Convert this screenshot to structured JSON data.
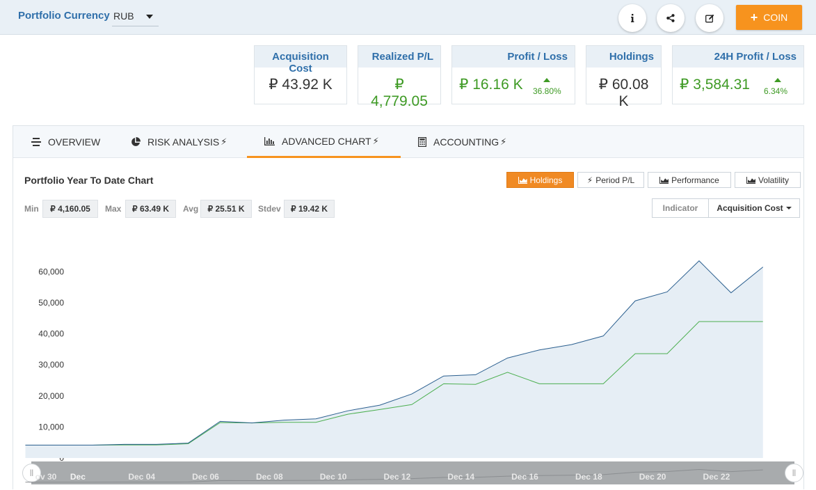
{
  "header": {
    "currency_label": "Portfolio Currency",
    "currency_value": "RUB",
    "info_icon": "info-icon",
    "share_icon": "share-icon",
    "edit_icon": "edit-icon",
    "add_button": "COIN"
  },
  "stats": {
    "acquisition_cost": {
      "label": "Acquisition Cost",
      "value": "₽ 43.92 K"
    },
    "realized_pl": {
      "label": "Realized P/L",
      "value": "₽ 4,779.05"
    },
    "profit_loss": {
      "label": "Profit / Loss",
      "value": "₽ 16.16 K",
      "pct": "36.80%"
    },
    "holdings": {
      "label": "Holdings",
      "value": "₽ 60.08 K"
    },
    "profit_24h": {
      "label": "24H Profit / Loss",
      "value": "₽ 3,584.31",
      "pct": "6.34%"
    }
  },
  "tabs": [
    {
      "label": "OVERVIEW",
      "icon": "list-icon"
    },
    {
      "label": "RISK ANALYSIS",
      "icon": "pie-icon"
    },
    {
      "label": "ADVANCED CHART",
      "icon": "bar-chart-icon",
      "active": true
    },
    {
      "label": "ACCOUNTING",
      "icon": "calculator-icon"
    }
  ],
  "chart_panel": {
    "title": "Portfolio Year To Date Chart",
    "type_buttons": [
      "Holdings",
      "Period P/L",
      "Performance",
      "Volatility"
    ],
    "active_type": "Holdings",
    "summary": {
      "min_label": "Min",
      "min_value": "₽ 4,160.05",
      "max_label": "Max",
      "max_value": "₽ 63.49 K",
      "avg_label": "Avg",
      "avg_value": "₽ 25.51 K",
      "stdev_label": "Stdev",
      "stdev_value": "₽ 19.42 K"
    },
    "indicator_label": "Indicator",
    "indicator_value": "Acquisition Cost"
  },
  "colors": {
    "accent": "#f7931e",
    "brand_blue": "#2f6faa",
    "green": "#3e9a24",
    "holdings_line": "#2b5f8f",
    "holdings_fill": "#e6eef5",
    "cost_line": "#4caf50"
  },
  "chart_data": {
    "type": "area",
    "ylim": [
      0,
      65000
    ],
    "y_ticks": [
      "0",
      "10,000",
      "20,000",
      "30,000",
      "40,000",
      "50,000",
      "60,000"
    ],
    "y_tick_values": [
      0,
      10000,
      20000,
      30000,
      40000,
      50000,
      60000
    ],
    "x_ticks": [
      "ov 30",
      "Dec",
      "Dec 04",
      "Dec 06",
      "Dec 08",
      "Dec 10",
      "Dec 12",
      "Dec 14",
      "Dec 16",
      "Dec 18",
      "Dec 20",
      "Dec 22"
    ],
    "x_tick_days": [
      0,
      1,
      3,
      5,
      7,
      9,
      11,
      13,
      15,
      17,
      19,
      21
    ],
    "x_start_label": "Nov 30",
    "grid": false,
    "series": [
      {
        "x": [
          -0.6,
          0.5,
          1.5,
          2.5,
          3.5,
          4.5,
          5.5,
          6.5,
          7.5,
          8.5,
          9.5,
          10.5,
          11.5,
          12.5,
          13.5,
          14.5,
          15.5,
          16.5,
          17.5,
          18.5,
          19.5,
          20.5,
          21.5,
          22.5
        ],
        "values": [
          4160,
          4160,
          4160,
          4400,
          4400,
          4800,
          11800,
          11300,
          12200,
          12600,
          15200,
          17000,
          20600,
          26400,
          26800,
          32200,
          34800,
          36500,
          39300,
          50600,
          53500,
          63490,
          53200,
          61500
        ]
      },
      {
        "x": [
          -0.6,
          0.5,
          1.5,
          2.5,
          3.5,
          4.5,
          5.5,
          6.5,
          7.5,
          8.5,
          9.5,
          10.5,
          11.5,
          12.5,
          13.5,
          14.5,
          15.5,
          16.5,
          17.5,
          18.5,
          19.5,
          20.5,
          21.5,
          22.5
        ],
        "values": [
          4160,
          4160,
          4160,
          4200,
          4200,
          4600,
          11400,
          11300,
          11500,
          11500,
          14100,
          15600,
          17200,
          23900,
          23700,
          27600,
          23900,
          23900,
          23900,
          33600,
          33600,
          43920,
          43920,
          43920
        ]
      }
    ]
  }
}
